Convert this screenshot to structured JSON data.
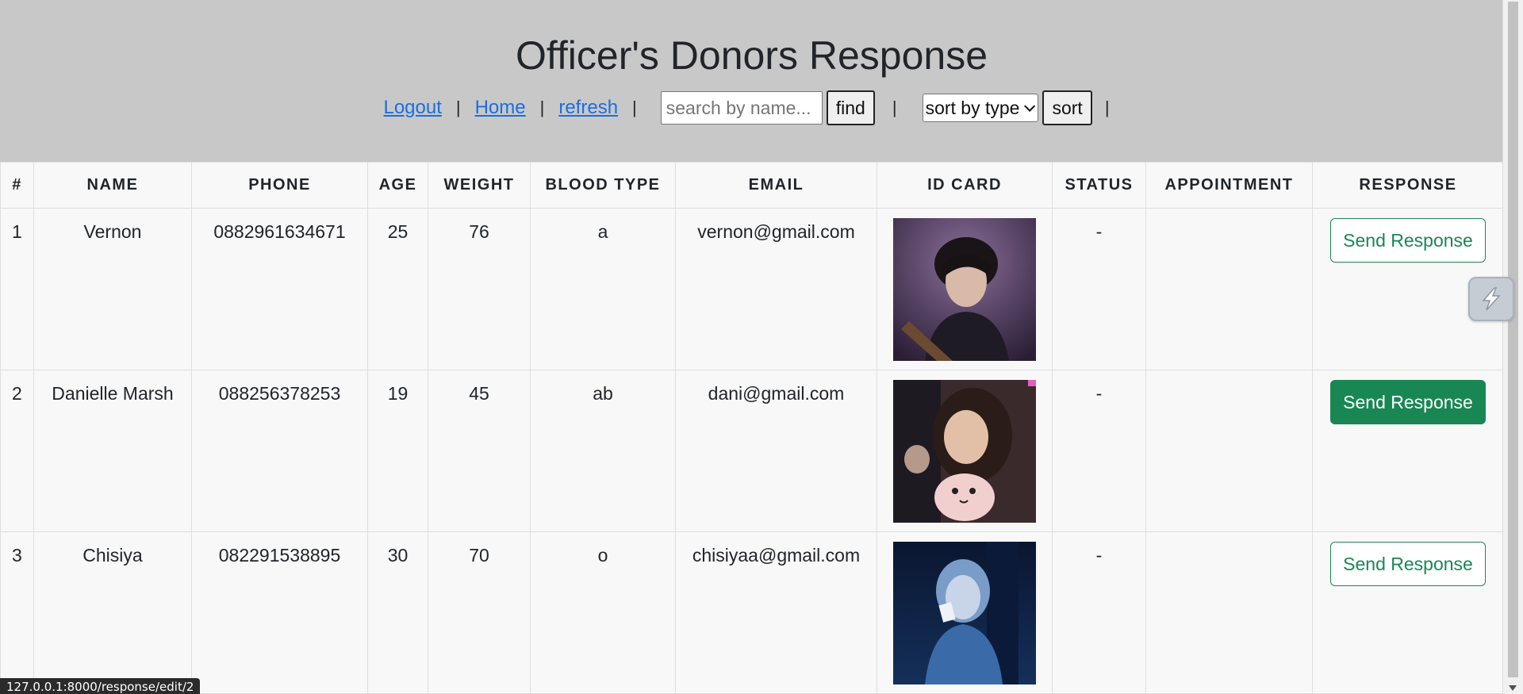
{
  "header": {
    "title": "Officer's Donors Response",
    "nav": {
      "logout": "Logout",
      "home": "Home",
      "refresh": "refresh",
      "separator": "|"
    },
    "search": {
      "placeholder": "search by name...",
      "value": "",
      "find_label": "find"
    },
    "sort": {
      "selected": "sort by type",
      "sort_label": "sort"
    }
  },
  "table": {
    "headers": [
      "#",
      "NAME",
      "PHONE",
      "AGE",
      "WEIGHT",
      "BLOOD TYPE",
      "EMAIL",
      "ID CARD",
      "STATUS",
      "APPOINTMENT",
      "RESPONSE"
    ],
    "rows": [
      {
        "num": "1",
        "name": "Vernon",
        "phone": "0882961634671",
        "age": "25",
        "weight": "76",
        "blood": "a",
        "email": "vernon@gmail.com",
        "status": "-",
        "appointment": "",
        "response": "Send Response"
      },
      {
        "num": "2",
        "name": "Danielle Marsh",
        "phone": "088256378253",
        "age": "19",
        "weight": "45",
        "blood": "ab",
        "email": "dani@gmail.com",
        "status": "-",
        "appointment": "",
        "response": "Send Response"
      },
      {
        "num": "3",
        "name": "Chisiya",
        "phone": "082291538895",
        "age": "30",
        "weight": "70",
        "blood": "o",
        "email": "chisiyaa@gmail.com",
        "status": "-",
        "appointment": "",
        "response": "Send Response"
      }
    ]
  },
  "statusbar": {
    "url": "127.0.0.1:8000/response/edit/2"
  },
  "colors": {
    "header_bg": "#c8c8c8",
    "link": "#1a6ee0",
    "success": "#198754"
  },
  "icons": {
    "id_card": "id-card-photo",
    "widget": "floating-extension-icon"
  }
}
